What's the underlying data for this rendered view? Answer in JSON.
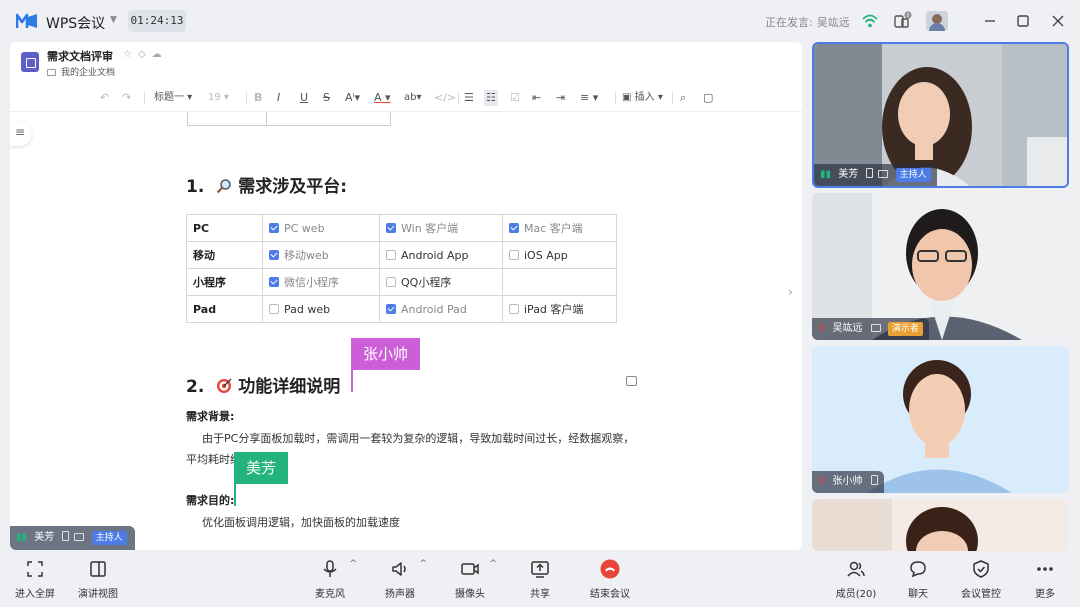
{
  "window": {
    "app_title": "WPS会议",
    "timer": "01:24:13",
    "speaking_label": "正在发言:",
    "speaking_name": "吴竑远",
    "notification_count": "0"
  },
  "doc": {
    "title": "需求文档评审",
    "folder": "我的企业文档",
    "toolbar": {
      "heading_style": "标题一",
      "font_size": "19",
      "insert_label": "插入"
    },
    "section1": {
      "number": "1.",
      "title": "需求涉及平台:"
    },
    "platform_table": {
      "rows": [
        {
          "label": "PC",
          "cells": [
            {
              "text": "PC web",
              "checked": true
            },
            {
              "text": "Win 客户端",
              "checked": true
            },
            {
              "text": "Mac 客户端",
              "checked": true
            }
          ]
        },
        {
          "label": "移动",
          "cells": [
            {
              "text": "移动web",
              "checked": true
            },
            {
              "text": "Android App",
              "checked": false
            },
            {
              "text": "iOS App",
              "checked": false
            }
          ]
        },
        {
          "label": "小程序",
          "cells": [
            {
              "text": "微信小程序",
              "checked": true
            },
            {
              "text": "QQ小程序",
              "checked": false
            },
            {
              "text": "",
              "checked": null
            }
          ]
        },
        {
          "label": "Pad",
          "cells": [
            {
              "text": "Pad web",
              "checked": false
            },
            {
              "text": "Android Pad",
              "checked": true
            },
            {
              "text": "iPad 客户端",
              "checked": false
            }
          ]
        }
      ]
    },
    "section2": {
      "number": "2.",
      "title": "功能详细说明"
    },
    "background_label": "需求背景:",
    "background_text": "由于PC分享面板加载时，需调用一套较为复杂的逻辑，导致加载时间过长，经数据观察，平均耗时约4s。",
    "goal_label": "需求目的:",
    "goal_text": "优化面板调用逻辑，加快面板的加载速度",
    "cursors": {
      "zhang": "张小帅",
      "mei": "美芳"
    }
  },
  "self_view": {
    "name": "美芳",
    "role": "主持人"
  },
  "participants": [
    {
      "name": "美芳",
      "role": "主持人"
    },
    {
      "name": "吴竑远",
      "role": "演示者"
    },
    {
      "name": "张小帅",
      "role": ""
    },
    {
      "name": "",
      "role": ""
    }
  ],
  "bottom_bar": {
    "fullscreen": "进入全屏",
    "speaker_view": "演讲视图",
    "mic": "麦克风",
    "speaker": "扬声器",
    "camera": "摄像头",
    "share": "共享",
    "end": "结束会议",
    "members": "成员(20)",
    "chat": "聊天",
    "control": "会议管控",
    "more": "更多"
  },
  "colors": {
    "accent": "#4e7ce6",
    "end_red": "#e8453c",
    "cursor_zhang": "#cc5fd8",
    "cursor_mei": "#23b37c",
    "presenter": "#e8a033"
  }
}
